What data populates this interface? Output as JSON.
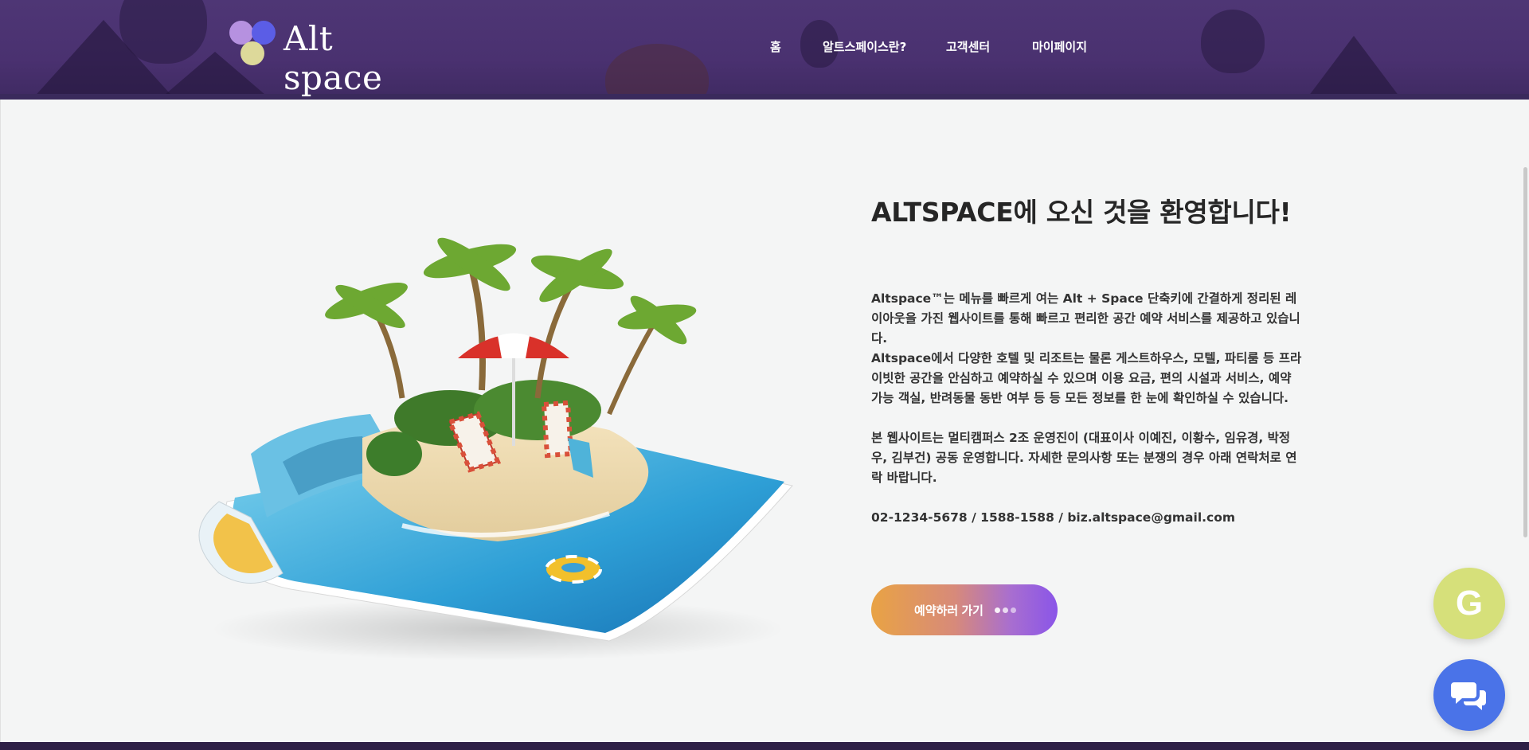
{
  "header": {
    "logo_text": "Alt space",
    "nav": [
      {
        "label": "홈"
      },
      {
        "label": "알트스페이스란?"
      },
      {
        "label": "고객센터"
      },
      {
        "label": "마이페이지"
      }
    ]
  },
  "main": {
    "title": "ALTSPACE에 오신 것을 환영합니다!",
    "paragraphs": [
      "Altspace™는 메뉴를 빠르게 여는 Alt + Space 단축키에 간결하게 정리된 레이아웃을 가진 웹사이트를 통해 빠르고 편리한 공간 예약 서비스를 제공하고 있습니다.",
      "Altspace에서 다양한 호텔 및 리조트는 물론 게스트하우스, 모텔, 파티룸 등 프라이빗한 공간을 안심하고 예약하실 수 있으며 이용 요금, 편의 시설과 서비스, 예약 가능 객실, 반려동물 동반 여부 등 등 모든 정보를 한 눈에 확인하실 수 있습니다.",
      "본 웹사이트는 멀티캠퍼스 2조 운영진이 (대표이사 이예진, 이황수, 임유경, 박정우, 김부건) 공동 운영합니다. 자세한 문의사항 또는 분쟁의 경우 아래 연락처로 연락 바랍니다."
    ],
    "contact": "02-1234-5678 / 1588-1588 / biz.altspace@gmail.com",
    "cta_label": "예약하러 가기"
  },
  "floating": {
    "g_label": "G",
    "g_icon": "g-letter-icon",
    "chat_icon": "chat-bubbles-icon"
  },
  "colors": {
    "header_bg": "#4e3675",
    "cta_start": "#e9a344",
    "cta_end": "#8a55e8",
    "fab_g": "#d6e07a",
    "fab_chat": "#4a73e8"
  }
}
